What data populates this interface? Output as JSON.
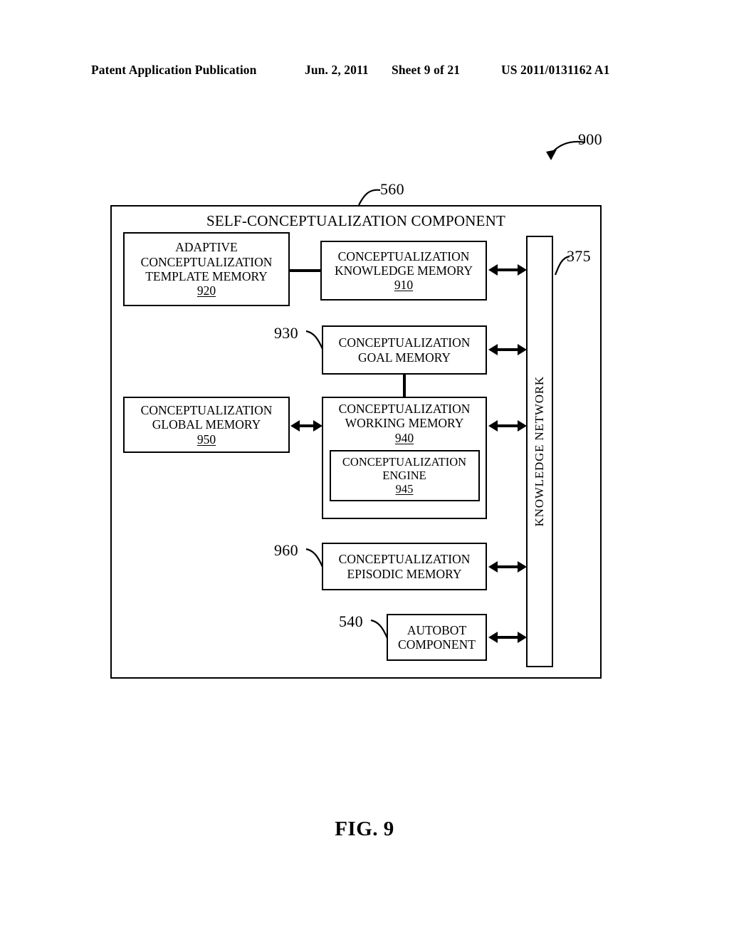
{
  "header": {
    "publication": "Patent Application Publication",
    "date": "Jun. 2, 2011",
    "sheet": "Sheet 9 of 21",
    "patent_number": "US 2011/0131162 A1"
  },
  "figure": {
    "caption": "FIG. 9",
    "figure_callout": "900"
  },
  "diagram": {
    "outer": {
      "title": "SELF-CONCEPTUALIZATION COMPONENT",
      "callout": "560"
    },
    "network_bar": {
      "label": "KNOWLEDGE NETWORK",
      "callout": "375"
    },
    "boxes": [
      {
        "id": "template",
        "lines": [
          "ADAPTIVE",
          "CONCEPTUALIZATION",
          "TEMPLATE MEMORY"
        ],
        "refnum": "920"
      },
      {
        "id": "knowledge",
        "lines": [
          "CONCEPTUALIZATION",
          "KNOWLEDGE MEMORY"
        ],
        "refnum": "910"
      },
      {
        "id": "goal",
        "lines": [
          "CONCEPTUALIZATION",
          "GOAL MEMORY"
        ],
        "refnum": "",
        "callout": "930"
      },
      {
        "id": "global",
        "lines": [
          "CONCEPTUALIZATION",
          "GLOBAL MEMORY"
        ],
        "refnum": "950"
      },
      {
        "id": "working",
        "lines": [
          "CONCEPTUALIZATION",
          "WORKING MEMORY"
        ],
        "refnum": "940"
      },
      {
        "id": "engine",
        "lines": [
          "CONCEPTUALIZATION",
          "ENGINE"
        ],
        "refnum": "945"
      },
      {
        "id": "episodic",
        "lines": [
          "CONCEPTUALIZATION",
          "EPISODIC MEMORY"
        ],
        "refnum": "",
        "callout": "960"
      },
      {
        "id": "autobot",
        "lines": [
          "AUTOBOT",
          "COMPONENT"
        ],
        "refnum": "",
        "callout": "540"
      }
    ]
  }
}
